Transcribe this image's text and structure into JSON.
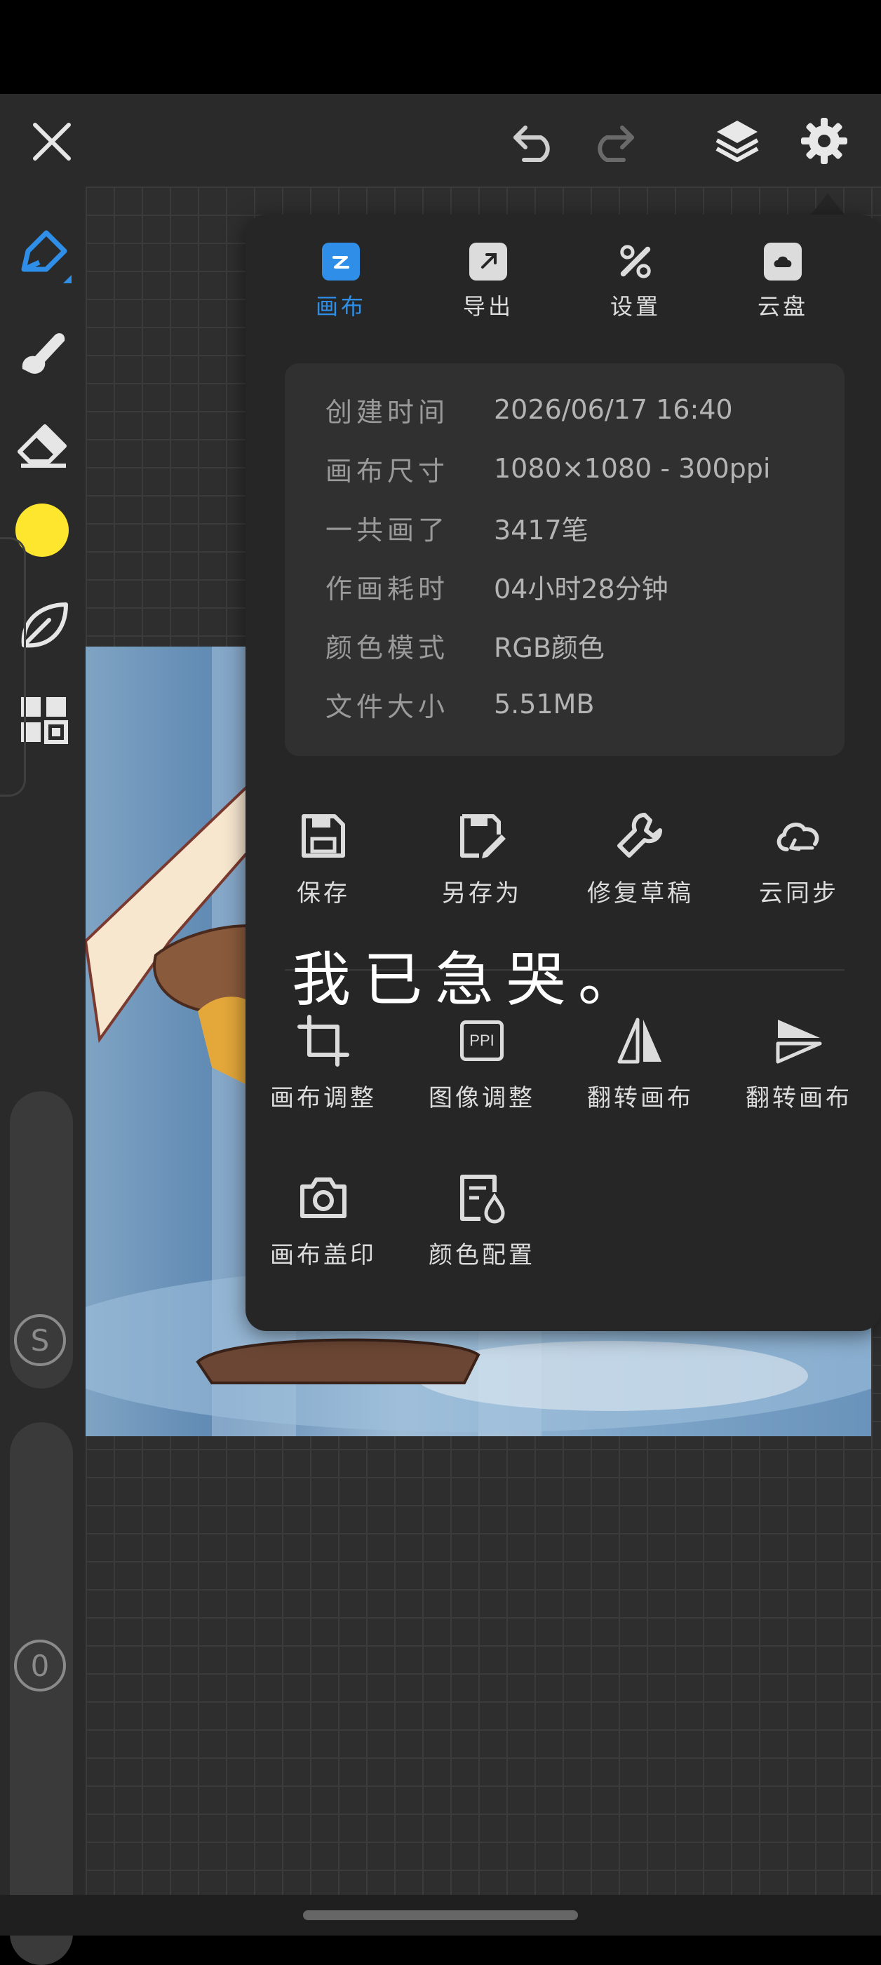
{
  "toolbar": {
    "close": "close",
    "undo": "undo",
    "redo": "redo",
    "layers": "layers",
    "settings": "settings"
  },
  "sidebar": {
    "tools": [
      "pen-icon",
      "smudge-icon",
      "eraser-icon",
      "color-swatch",
      "leaf-icon",
      "grid-icon"
    ],
    "active_color": "#FFE62E",
    "s_label": "S",
    "o_label": "0"
  },
  "menu": {
    "tabs": [
      {
        "label": "画布",
        "icon": "canvas-icon",
        "active": true
      },
      {
        "label": "导出",
        "icon": "export-icon"
      },
      {
        "label": "设置",
        "icon": "settings-tools-icon"
      },
      {
        "label": "云盘",
        "icon": "cloud-drive-icon"
      }
    ],
    "info": [
      {
        "key": "创建时间",
        "value": "2026/06/17 16:40"
      },
      {
        "key": "画布尺寸",
        "value": "1080×1080 - 300ppi"
      },
      {
        "key": "一共画了",
        "value": "3417笔"
      },
      {
        "key": "作画耗时",
        "value": "04小时28分钟"
      },
      {
        "key": "颜色模式",
        "value": "RGB颜色"
      },
      {
        "key": "文件大小",
        "value": "5.51MB"
      }
    ],
    "actions": [
      {
        "label": "保存",
        "icon": "save-icon"
      },
      {
        "label": "另存为",
        "icon": "save-as-icon"
      },
      {
        "label": "修复草稿",
        "icon": "wrench-icon"
      },
      {
        "label": "云同步",
        "icon": "cloud-sync-icon"
      },
      {
        "label": "画布调整",
        "icon": "crop-icon"
      },
      {
        "label": "图像调整",
        "icon": "ppi-icon"
      },
      {
        "label": "翻转画布",
        "icon": "flip-horizontal-icon"
      },
      {
        "label": "翻转画布",
        "icon": "flip-vertical-icon"
      },
      {
        "label": "画布盖印",
        "icon": "camera-icon"
      },
      {
        "label": "颜色配置",
        "icon": "color-config-icon"
      }
    ],
    "ppi_text": "PPI"
  },
  "overlay_text": "我已急哭。",
  "colors": {
    "accent": "#2F8FE8",
    "menu_bg": "#262626",
    "info_bg": "#303030"
  }
}
